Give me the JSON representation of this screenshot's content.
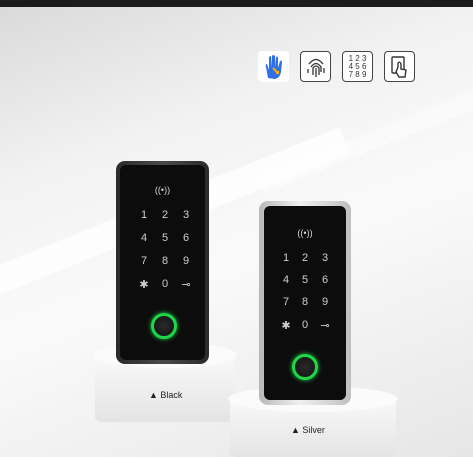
{
  "icons": [
    {
      "name": "palm-icon",
      "color": "#2f6fe8"
    },
    {
      "name": "fingerprint-icon"
    },
    {
      "name": "keypad-icon",
      "digits": [
        "1 2 3",
        "4 5 6",
        "7 8 9"
      ]
    },
    {
      "name": "card-icon"
    }
  ],
  "black_lock": {
    "rfid": "((•))",
    "keys": [
      "1",
      "2",
      "3",
      "4",
      "5",
      "6",
      "7",
      "8",
      "9",
      "✱",
      "0",
      "⊸"
    ],
    "caption": "▲ Black",
    "ring_color": "#1fd84a"
  },
  "silver_lock": {
    "rfid": "((•))",
    "keys": [
      "1",
      "2",
      "3",
      "4",
      "5",
      "6",
      "7",
      "8",
      "9",
      "✱",
      "0",
      "⊸"
    ],
    "caption": "▲ Silver",
    "ring_color": "#1fd84a"
  }
}
